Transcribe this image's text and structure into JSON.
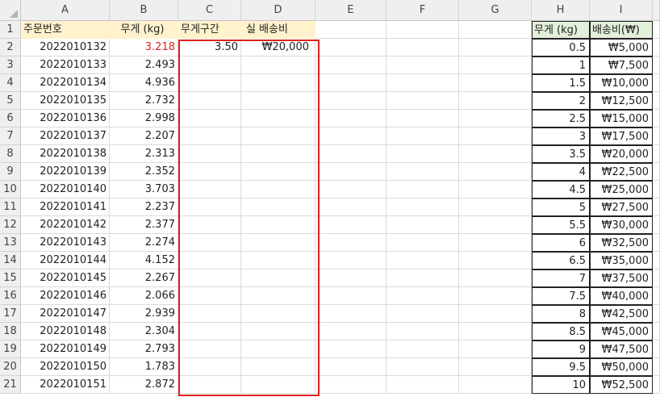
{
  "columns": [
    "A",
    "B",
    "C",
    "D",
    "E",
    "F",
    "G",
    "H",
    "I"
  ],
  "rows": [
    "1",
    "2",
    "3",
    "4",
    "5",
    "6",
    "7",
    "8",
    "9",
    "10",
    "11",
    "12",
    "13",
    "14",
    "15",
    "16",
    "17",
    "18",
    "19",
    "20",
    "21"
  ],
  "headers": {
    "order_no": "주문번호",
    "weight": "무게 (kg)",
    "weight_bracket": "무게구간",
    "actual_fee": "실 배송비"
  },
  "orders": [
    {
      "id": "2022010132",
      "w": "3.218",
      "bracket": "3.50",
      "fee": "₩20,000"
    },
    {
      "id": "2022010133",
      "w": "2.493"
    },
    {
      "id": "2022010134",
      "w": "4.936"
    },
    {
      "id": "2022010135",
      "w": "2.732"
    },
    {
      "id": "2022010136",
      "w": "2.998"
    },
    {
      "id": "2022010137",
      "w": "2.207"
    },
    {
      "id": "2022010138",
      "w": "2.313"
    },
    {
      "id": "2022010139",
      "w": "2.352"
    },
    {
      "id": "2022010140",
      "w": "3.703"
    },
    {
      "id": "2022010141",
      "w": "2.237"
    },
    {
      "id": "2022010142",
      "w": "2.377"
    },
    {
      "id": "2022010143",
      "w": "2.274"
    },
    {
      "id": "2022010144",
      "w": "4.152"
    },
    {
      "id": "2022010145",
      "w": "2.267"
    },
    {
      "id": "2022010146",
      "w": "2.066"
    },
    {
      "id": "2022010147",
      "w": "2.939"
    },
    {
      "id": "2022010148",
      "w": "2.304"
    },
    {
      "id": "2022010149",
      "w": "2.793"
    },
    {
      "id": "2022010150",
      "w": "1.783"
    },
    {
      "id": "2022010151",
      "w": "2.872"
    }
  ],
  "rate_table": {
    "weight_header": "무게 (kg)",
    "fee_header": "배송비(₩)",
    "rows": [
      {
        "w": "0.5",
        "fee": "₩5,000"
      },
      {
        "w": "1",
        "fee": "₩7,500"
      },
      {
        "w": "1.5",
        "fee": "₩10,000"
      },
      {
        "w": "2",
        "fee": "₩12,500"
      },
      {
        "w": "2.5",
        "fee": "₩15,000"
      },
      {
        "w": "3",
        "fee": "₩17,500"
      },
      {
        "w": "3.5",
        "fee": "₩20,000"
      },
      {
        "w": "4",
        "fee": "₩22,500"
      },
      {
        "w": "4.5",
        "fee": "₩25,000"
      },
      {
        "w": "5",
        "fee": "₩27,500"
      },
      {
        "w": "5.5",
        "fee": "₩30,000"
      },
      {
        "w": "6",
        "fee": "₩32,500"
      },
      {
        "w": "6.5",
        "fee": "₩35,000"
      },
      {
        "w": "7",
        "fee": "₩37,500"
      },
      {
        "w": "7.5",
        "fee": "₩40,000"
      },
      {
        "w": "8",
        "fee": "₩42,500"
      },
      {
        "w": "8.5",
        "fee": "₩45,000"
      },
      {
        "w": "9",
        "fee": "₩47,500"
      },
      {
        "w": "9.5",
        "fee": "₩50,000"
      },
      {
        "w": "10",
        "fee": "₩52,500"
      }
    ]
  },
  "colors": {
    "highlight_red": "#e02020",
    "header_yellow": "#fff2cc",
    "header_green": "#e2efda"
  }
}
